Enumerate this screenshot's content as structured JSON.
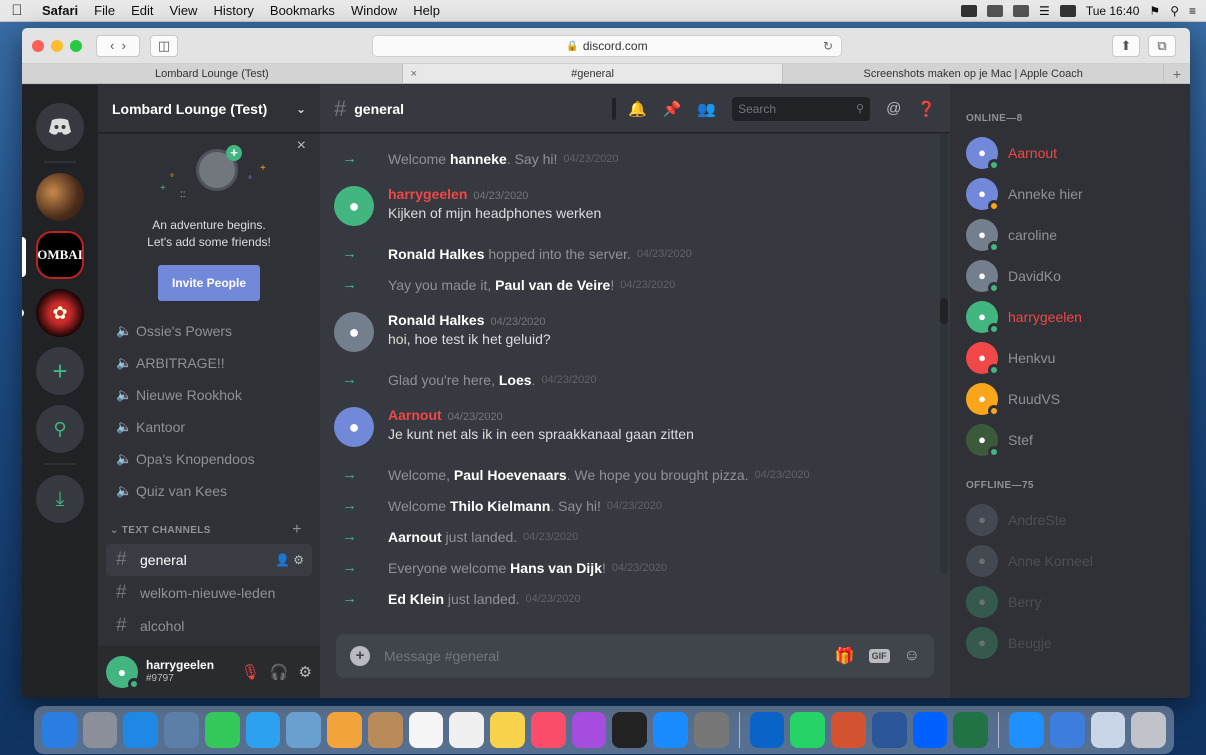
{
  "menubar": {
    "app": "Safari",
    "items": [
      "File",
      "Edit",
      "View",
      "History",
      "Bookmarks",
      "Window",
      "Help"
    ],
    "clock": "Tue 16:40"
  },
  "browser": {
    "address": "discord.com",
    "tabs": [
      {
        "label": "Lombard Lounge (Test)"
      },
      {
        "label": "#general"
      },
      {
        "label": "Screenshots maken op je Mac | Apple Coach"
      }
    ]
  },
  "server": {
    "name": "Lombard Lounge (Test)",
    "guild_label": "OMBAI",
    "invite": {
      "line1": "An adventure begins.",
      "line2": "Let's add some friends!",
      "button": "Invite People"
    },
    "voice_channels": [
      "Ossie's Powers",
      "ARBITRAGE!!",
      "Nieuwe Rookhok",
      "Kantoor",
      "Opa's Knopendoos",
      "Quiz van Kees"
    ],
    "text_category": "TEXT CHANNELS",
    "text_channels": [
      "general",
      "welkom-nieuwe-leden",
      "alcohol"
    ]
  },
  "user": {
    "name": "harrygeelen",
    "tag": "#9797"
  },
  "chat": {
    "channel": "general",
    "search_placeholder": "Search",
    "composer_placeholder": "Message #general",
    "gif_label": "GIF"
  },
  "messages": [
    {
      "kind": "sys",
      "pre": "Welcome ",
      "name": "hanneke",
      "post": ". Say hi!",
      "ts": "04/23/2020"
    },
    {
      "kind": "msg",
      "author": "harrygeelen",
      "color": "#f04747",
      "avatar": "#43b581",
      "ts": "04/23/2020",
      "text": "Kijken of mijn headphones werken"
    },
    {
      "kind": "sys",
      "pre": "",
      "name": "Ronald Halkes",
      "post": " hopped into the server.",
      "ts": "04/23/2020"
    },
    {
      "kind": "sys",
      "pre": "Yay you made it, ",
      "name": "Paul van de Veire",
      "post": "!",
      "ts": "04/23/2020"
    },
    {
      "kind": "msg",
      "author": "Ronald Halkes",
      "color": "#ffffff",
      "avatar": "#747f8d",
      "ts": "04/23/2020",
      "text": "hoi, hoe test ik het geluid?"
    },
    {
      "kind": "sys",
      "pre": "Glad you're here, ",
      "name": "Loes",
      "post": ".",
      "ts": "04/23/2020"
    },
    {
      "kind": "msg",
      "author": "Aarnout",
      "color": "#f04747",
      "avatar": "#7289da",
      "ts": "04/23/2020",
      "text": "Je kunt net als ik in een spraakkanaal gaan zitten"
    },
    {
      "kind": "sys",
      "pre": "Welcome, ",
      "name": "Paul Hoevenaars",
      "post": ". We hope you brought pizza.",
      "ts": "04/23/2020"
    },
    {
      "kind": "sys",
      "pre": "Welcome ",
      "name": "Thilo Kielmann",
      "post": ". Say hi!",
      "ts": "04/23/2020"
    },
    {
      "kind": "sys",
      "pre": "",
      "name": "Aarnout",
      "post": " just landed.",
      "ts": "04/23/2020"
    },
    {
      "kind": "sys",
      "pre": "Everyone welcome ",
      "name": "Hans van Dijk",
      "post": "!",
      "ts": "04/23/2020"
    },
    {
      "kind": "sys",
      "pre": "",
      "name": "Ed Klein",
      "post": " just landed.",
      "ts": "04/23/2020"
    }
  ],
  "members": {
    "online_header": "ONLINE—8",
    "offline_header": "OFFLINE—75",
    "online": [
      {
        "name": "Aarnout",
        "color": "#f04747",
        "avatar": "#7289da",
        "status": "#43b581"
      },
      {
        "name": "Anneke hier",
        "color": "#8e9297",
        "avatar": "#7289da",
        "status": "#faa61a"
      },
      {
        "name": "caroline",
        "color": "#8e9297",
        "avatar": "#747f8d",
        "status": "#43b581"
      },
      {
        "name": "DavidKo",
        "color": "#8e9297",
        "avatar": "#747f8d",
        "status": "#43b581"
      },
      {
        "name": "harrygeelen",
        "color": "#f04747",
        "avatar": "#43b581",
        "status": "#43b581"
      },
      {
        "name": "Henkvu",
        "color": "#8e9297",
        "avatar": "#f04747",
        "status": "#43b581"
      },
      {
        "name": "RuudVS",
        "color": "#8e9297",
        "avatar": "#faa61a",
        "status": "#faa61a"
      },
      {
        "name": "Stef",
        "color": "#8e9297",
        "avatar": "#3b5a3b",
        "status": "#43b581"
      }
    ],
    "offline": [
      {
        "name": "AndreSte",
        "avatar": "#747f8d"
      },
      {
        "name": "Anne Korneel",
        "avatar": "#747f8d"
      },
      {
        "name": "Berry",
        "avatar": "#43b581"
      },
      {
        "name": "Beugje",
        "avatar": "#43b581"
      }
    ]
  },
  "dock_icons": [
    "finder-icon",
    "launchpad-icon",
    "safari-icon",
    "photos-icon",
    "facetime-icon",
    "messages-icon",
    "preview-icon",
    "photos-flower-icon",
    "contacts-icon",
    "calendar-icon",
    "reminders-icon",
    "notes-icon",
    "music-icon",
    "podcasts-icon",
    "tv-icon",
    "app-store-icon",
    "system-preferences-icon",
    "outlook-icon",
    "whatsapp-icon",
    "powerpoint-icon",
    "word-icon",
    "dropbox-icon",
    "excel-icon",
    "downloads-icon",
    "documents-icon",
    "preview-folder-icon",
    "trash-icon"
  ]
}
